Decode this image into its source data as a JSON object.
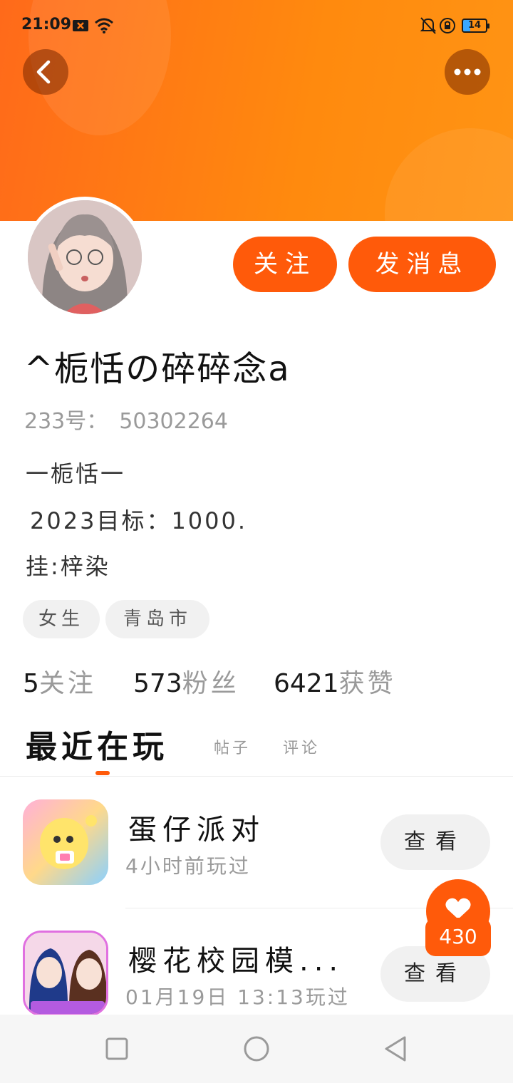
{
  "status_bar": {
    "time": "21:09",
    "battery": "14",
    "icons": [
      "notification-x-icon",
      "wifi-icon",
      "bell-muted-icon",
      "rotation-lock-icon",
      "battery-icon"
    ]
  },
  "header": {
    "accent_color": "#ff6a1a",
    "back_icon": "chevron-left-icon",
    "more_icon": "more-dots-icon"
  },
  "profile": {
    "follow_label": "关注",
    "message_label": "发消息",
    "username": "^栀恬の碎碎念a",
    "uid_label": "233号：",
    "uid_value": "50302264",
    "bio": [
      "一栀恬一",
      "2023目标：1000.",
      "挂:梓染"
    ],
    "tags": [
      "女生",
      "青岛市"
    ]
  },
  "stats": [
    {
      "value": "5",
      "label": "关注"
    },
    {
      "value": "573",
      "label": "粉丝"
    },
    {
      "value": "6421",
      "label": "获赞"
    }
  ],
  "tabs": {
    "active": "最近在玩",
    "posts": "帖子",
    "comments": "评论"
  },
  "games": [
    {
      "title": "蛋仔派对",
      "subtitle": "4小时前玩过",
      "view_label": "查看"
    },
    {
      "title": "樱花校园模...",
      "subtitle": "01月19日 13:13玩过",
      "view_label": "查看"
    }
  ],
  "floating": {
    "like_count": "430",
    "icon": "heart-icon"
  },
  "nav_bar": {
    "icons": [
      "recent-apps-icon",
      "home-icon",
      "back-triangle-icon"
    ]
  }
}
